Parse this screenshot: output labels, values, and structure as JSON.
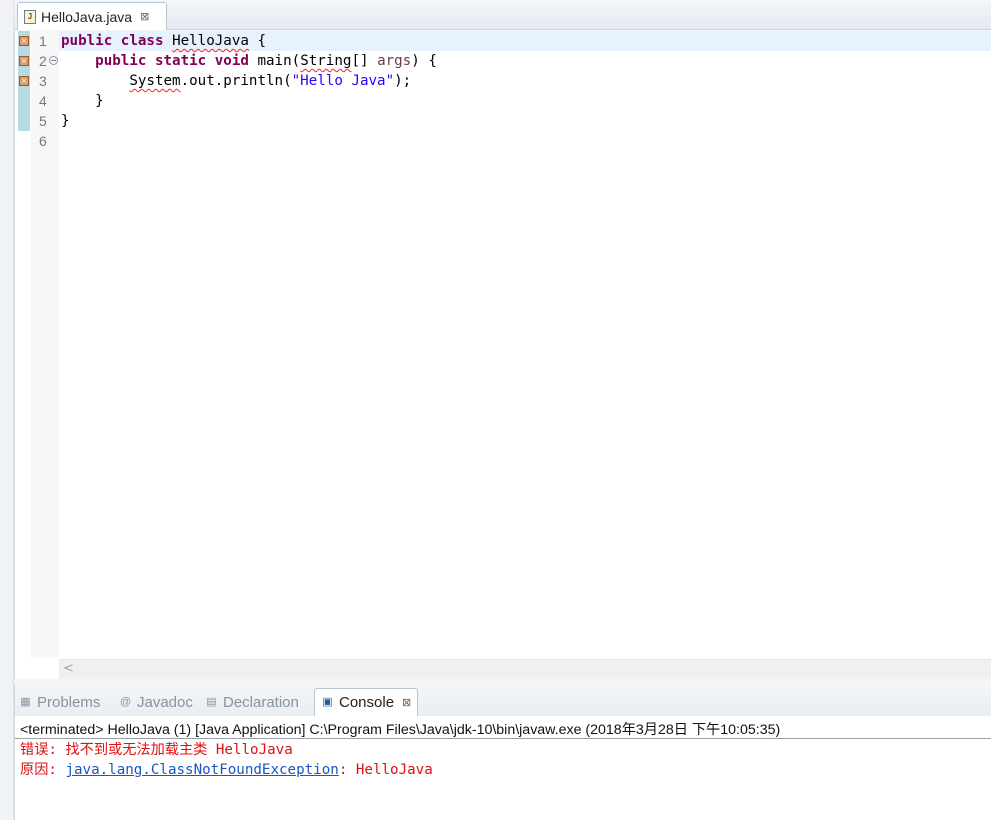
{
  "editor": {
    "tab": {
      "file_icon": "J",
      "label": "HelloJava.java",
      "close_glyph": "⊠"
    },
    "line_numbers": [
      "1",
      "2",
      "3",
      "4",
      "5",
      "6"
    ],
    "code": {
      "l1_kw1": "public",
      "l1_kw2": "class",
      "l1_name": "HelloJava",
      "l1_end": " {",
      "l2_kw1": "public",
      "l2_kw2": "static",
      "l2_kw3": "void",
      "l2_method": " main(",
      "l2_type": "String",
      "l2_arr": "[] ",
      "l2_param": "args",
      "l2_end": ") {",
      "l3_sys": "System",
      "l3_mid": ".out.println(",
      "l3_str": "\"Hello Java\"",
      "l3_end": ");",
      "l4": "}",
      "l5": "}"
    },
    "scroll_left_glyph": "<"
  },
  "panel": {
    "tabs": [
      {
        "label": "Problems",
        "icon": "problems-icon",
        "glyph": "▦"
      },
      {
        "label": "Javadoc",
        "icon": "at-icon",
        "glyph": "@"
      },
      {
        "label": "Declaration",
        "icon": "declaration-icon",
        "glyph": "▤"
      },
      {
        "label": "Console",
        "icon": "console-icon",
        "glyph": "▣",
        "close_glyph": "⊠"
      }
    ],
    "console": {
      "header": "<terminated> HelloJava (1) [Java Application] C:\\Program Files\\Java\\jdk-10\\bin\\javaw.exe (2018年3月28日 下午10:05:35)",
      "line1": "错误: 找不到或无法加载主类 HelloJava",
      "line2_prefix": "原因: ",
      "line2_link": "java.lang.ClassNotFoundException",
      "line2_suffix": ": HelloJava"
    }
  },
  "colors": {
    "keyword": "#7f0055",
    "string": "#2a00ff",
    "error_text": "#e01010",
    "link": "#1a55c4"
  }
}
